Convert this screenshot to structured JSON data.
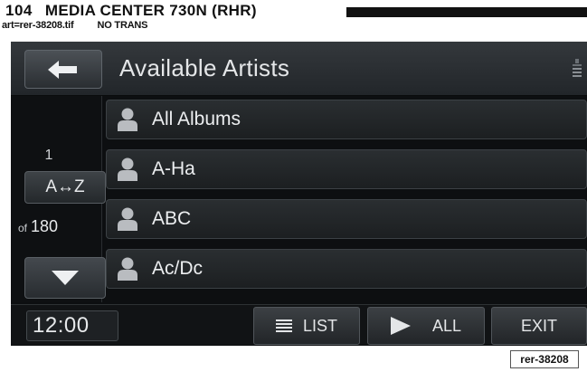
{
  "page_header": {
    "page_number": "104",
    "title": "MEDIA CENTER 730N (RHR)",
    "art_ref": "art=rer-38208.tif",
    "trans_note": "NO TRANS"
  },
  "screen": {
    "title": "Available Artists",
    "position": "1",
    "sort_label": "A↔Z",
    "of_label": "of",
    "total": "180",
    "list_items": [
      {
        "label": "All Albums",
        "icon": "person-icon"
      },
      {
        "label": "A-Ha",
        "icon": "person-icon"
      },
      {
        "label": "ABC",
        "icon": "person-icon"
      },
      {
        "label": "Ac/Dc",
        "icon": "person-icon"
      }
    ],
    "bottom_bar": {
      "clock": "12:00",
      "list_label": "LIST",
      "all_label": "ALL",
      "exit_label": "EXIT"
    },
    "icons": {
      "back": "back-arrow-icon",
      "down": "down-arrow-icon",
      "list": "list-icon",
      "play": "play-icon",
      "signal": "signal-strength-icon"
    }
  },
  "figure_tag": "rer-38208"
}
